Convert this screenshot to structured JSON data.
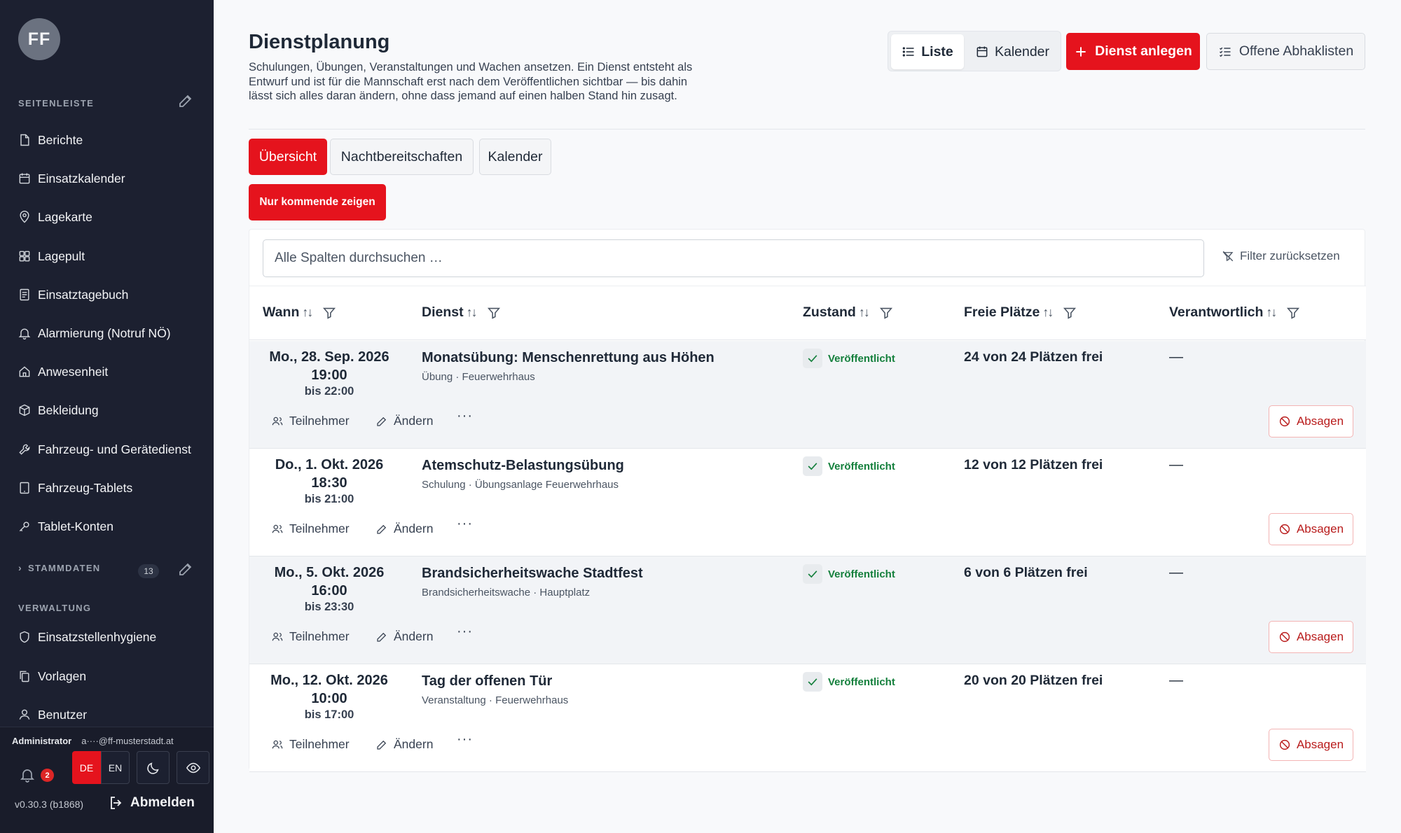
{
  "sidebar": {
    "avatar_initials": "FF",
    "section_label": "SEITENLEISTE",
    "items": [
      {
        "label": "Berichte",
        "icon": "file-icon"
      },
      {
        "label": "Einsatzkalender",
        "icon": "calendar-icon"
      },
      {
        "label": "Lagekarte",
        "icon": "map-pin-icon"
      },
      {
        "label": "Lagepult",
        "icon": "grid-icon"
      },
      {
        "label": "Einsatztagebuch",
        "icon": "list-doc-icon"
      },
      {
        "label": "Alarmierung (Notruf NÖ)",
        "icon": "bell-icon"
      },
      {
        "label": "Anwesenheit",
        "icon": "home-icon"
      },
      {
        "label": "Bekleidung",
        "icon": "box-icon"
      },
      {
        "label": "Fahrzeug- und Gerätedienst",
        "icon": "wrench-icon"
      },
      {
        "label": "Fahrzeug-Tablets",
        "icon": "tablet-icon"
      },
      {
        "label": "Tablet-Konten",
        "icon": "key-icon"
      }
    ],
    "stammdaten_label": "STAMMDATEN",
    "stammdaten_count": "13",
    "verwaltung_label": "VERWALTUNG",
    "admin_items": [
      {
        "label": "Einsatzstellenhygiene",
        "icon": "shield-icon"
      },
      {
        "label": "Vorlagen",
        "icon": "copy-icon"
      },
      {
        "label": "Benutzer",
        "icon": "user-icon"
      }
    ],
    "footer": {
      "role": "Administrator",
      "email": "a····@ff-musterstadt.at",
      "notification_count": "2",
      "lang_de": "DE",
      "lang_en": "EN",
      "version": "v0.30.3 (b1868)",
      "logout_label": "Abmelden"
    }
  },
  "header": {
    "title": "Dienstplanung",
    "description": "Schulungen, Übungen, Veranstaltungen und Wachen ansetzen. Ein Dienst entsteht als Entwurf und ist für die Mannschaft erst nach dem Veröffentlichen sichtbar — bis dahin lässt sich alles daran ändern, ohne dass jemand auf einen halben Stand hin zusagt.",
    "view_list": "Liste",
    "view_calendar": "Kalender",
    "create_button": "Dienst anlegen",
    "checklists_button": "Offene Abhaklisten"
  },
  "tabs": [
    "Übersicht",
    "Nachtbereitschaften",
    "Kalender"
  ],
  "filter_toggle": "Nur kommende zeigen",
  "table": {
    "search_placeholder": "Alle Spalten durchsuchen …",
    "reset_filters": "Filter zurücksetzen",
    "columns": [
      "Wann",
      "Dienst",
      "Zustand",
      "Freie Plätze",
      "Verantwortlich"
    ],
    "action_participants": "Teilnehmer",
    "action_edit": "Ändern",
    "action_more": "···",
    "action_cancel": "Absagen",
    "rows": [
      {
        "date": "Mo., 28. Sep. 2026",
        "time": "19:00",
        "until": "bis 22:00",
        "title": "Monatsübung: Menschenrettung aus Höhen",
        "sub": "Übung · Feuerwehrhaus",
        "state": "Veröffentlicht",
        "slots": "24 von 24 Plätzen frei",
        "responsible": "—"
      },
      {
        "date": "Do., 1. Okt. 2026",
        "time": "18:30",
        "until": "bis 21:00",
        "title": "Atemschutz-Belastungsübung",
        "sub": "Schulung · Übungsanlage Feuerwehrhaus",
        "state": "Veröffentlicht",
        "slots": "12 von 12 Plätzen frei",
        "responsible": "—"
      },
      {
        "date": "Mo., 5. Okt. 2026",
        "time": "16:00",
        "until": "bis 23:30",
        "title": "Brandsicherheitswache Stadtfest",
        "sub": "Brandsicherheitswache · Hauptplatz",
        "state": "Veröffentlicht",
        "slots": "6 von 6 Plätzen frei",
        "responsible": "—"
      },
      {
        "date": "Mo., 12. Okt. 2026",
        "time": "10:00",
        "until": "bis 17:00",
        "title": "Tag der offenen Tür",
        "sub": "Veranstaltung · Feuerwehrhaus",
        "state": "Veröffentlicht",
        "slots": "20 von 20 Plätzen frei",
        "responsible": "—"
      }
    ]
  },
  "colors": {
    "accent": "#e5131d",
    "sidebar_bg": "#1c2030",
    "success": "#15803d"
  }
}
